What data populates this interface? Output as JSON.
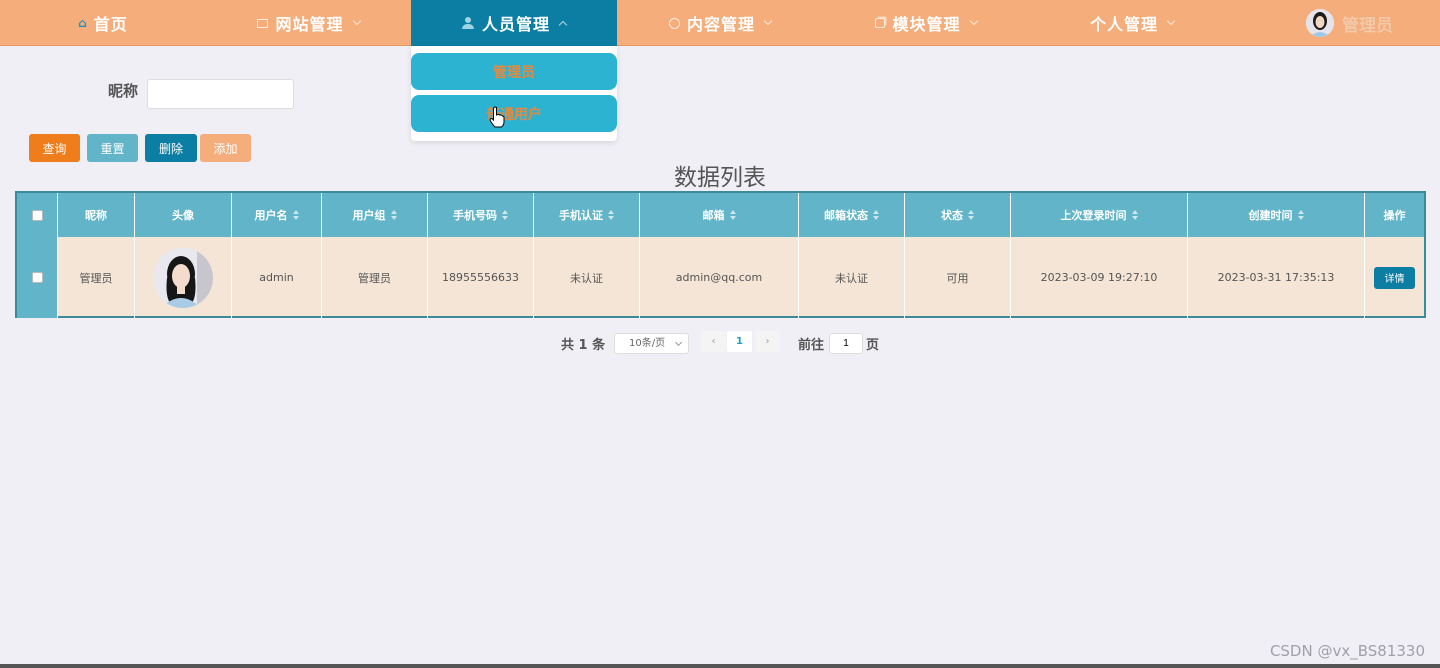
{
  "colors": {
    "nav_bg": "#f5ae7b",
    "nav_active": "#0c7ea3",
    "dropdown_item": "#2db3d2",
    "dropdown_text": "#e8883a",
    "table_header": "#62b4c9",
    "table_row": "#f4e5d6",
    "btn_query": "#f07d1c",
    "btn_reset": "#62b4c9",
    "btn_delete": "#0c7ea3",
    "btn_add": "#f5ae7b",
    "page_bg": "#f1eff6"
  },
  "nav": {
    "home": {
      "label": "首页",
      "icon": "home-icon"
    },
    "site": {
      "label": "网站管理",
      "icon": "monitor-icon"
    },
    "people": {
      "label": "人员管理",
      "icon": "user-icon"
    },
    "content": {
      "label": "内容管理",
      "icon": "chat-icon"
    },
    "module": {
      "label": "模块管理",
      "icon": "copy-icon"
    },
    "personal": {
      "label": "个人管理"
    },
    "user": {
      "name": "管理员",
      "icon": "avatar"
    }
  },
  "dropdown": {
    "items": [
      "管理员",
      "普通用户"
    ]
  },
  "search": {
    "label": "昵称",
    "value": "",
    "placeholder": ""
  },
  "buttons": {
    "query": "查询",
    "reset": "重置",
    "delete": "删除",
    "add": "添加"
  },
  "list_title": "数据列表",
  "table": {
    "columns": [
      "昵称",
      "头像",
      "用户名",
      "用户组",
      "手机号码",
      "手机认证",
      "邮箱",
      "邮箱状态",
      "状态",
      "上次登录时间",
      "创建时间",
      "操作"
    ],
    "rows": [
      {
        "nickname": "管理员",
        "username": "admin",
        "group": "管理员",
        "phone": "18955556633",
        "phone_auth": "未认证",
        "email": "admin@qq.com",
        "email_status": "未认证",
        "status": "可用",
        "last_login": "2023-03-09 19:27:10",
        "created": "2023-03-31 17:35:13",
        "action": "详情"
      }
    ]
  },
  "pagination": {
    "total": "共 1 条",
    "page_size": "10条/页",
    "current": "1",
    "goto_label": "前往",
    "goto_value": "1",
    "page_suffix": "页"
  },
  "watermark": "CSDN @vx_BS81330"
}
